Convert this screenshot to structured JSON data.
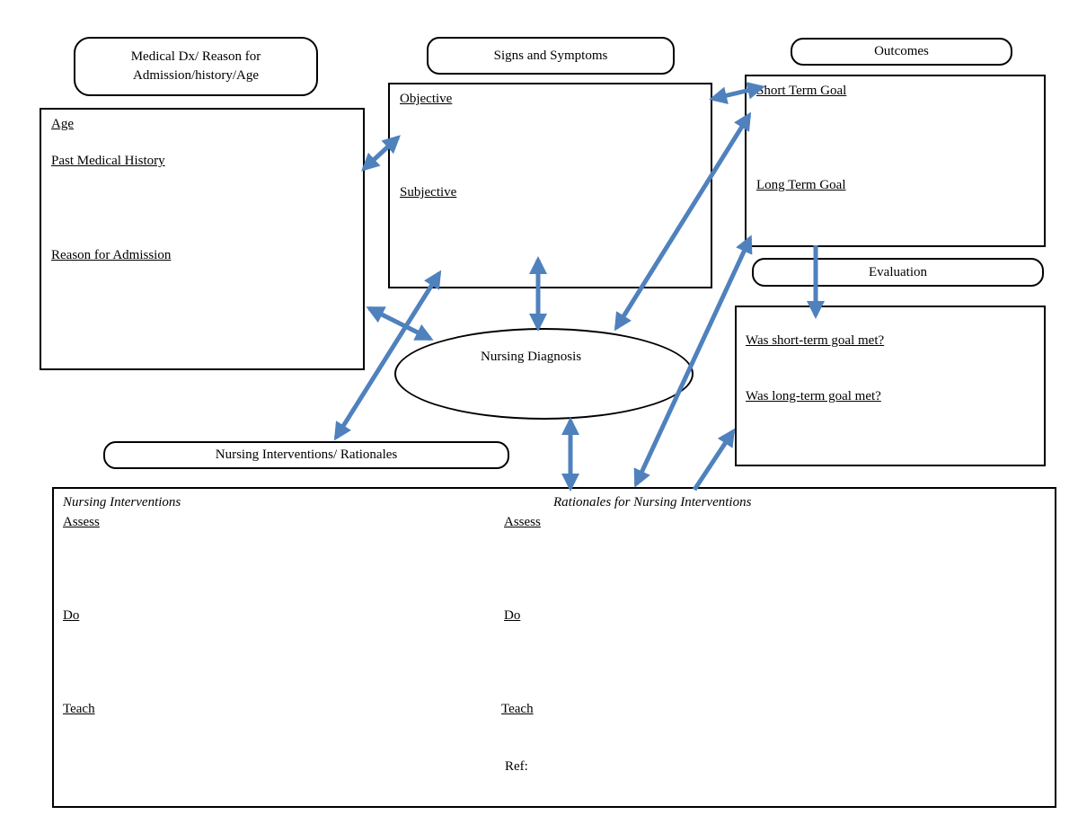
{
  "headers": {
    "medical": "Medical Dx/ Reason for Admission/history/Age",
    "signs": "Signs and Symptoms",
    "outcomes": "Outcomes",
    "evaluation": "Evaluation",
    "interventions": "Nursing Interventions/ Rationales"
  },
  "history_box": {
    "age": "Age",
    "past_history": "Past Medical History",
    "reason": "Reason for Admission"
  },
  "signs_box": {
    "objective": "Objective",
    "subjective": "Subjective"
  },
  "outcomes_box": {
    "short_term": "Short Term Goal",
    "long_term": "Long Term Goal"
  },
  "evaluation_box": {
    "short_met": "Was short-term goal met?",
    "long_met": "Was long-term goal met?"
  },
  "diagnosis": "Nursing Diagnosis",
  "bottom": {
    "left_title": "Nursing Interventions",
    "right_title": "Rationales for Nursing Interventions",
    "assess": "Assess",
    "do": "Do",
    "teach": "Teach",
    "ref": "Ref:"
  },
  "colors": {
    "arrow": "#4f81bd"
  }
}
